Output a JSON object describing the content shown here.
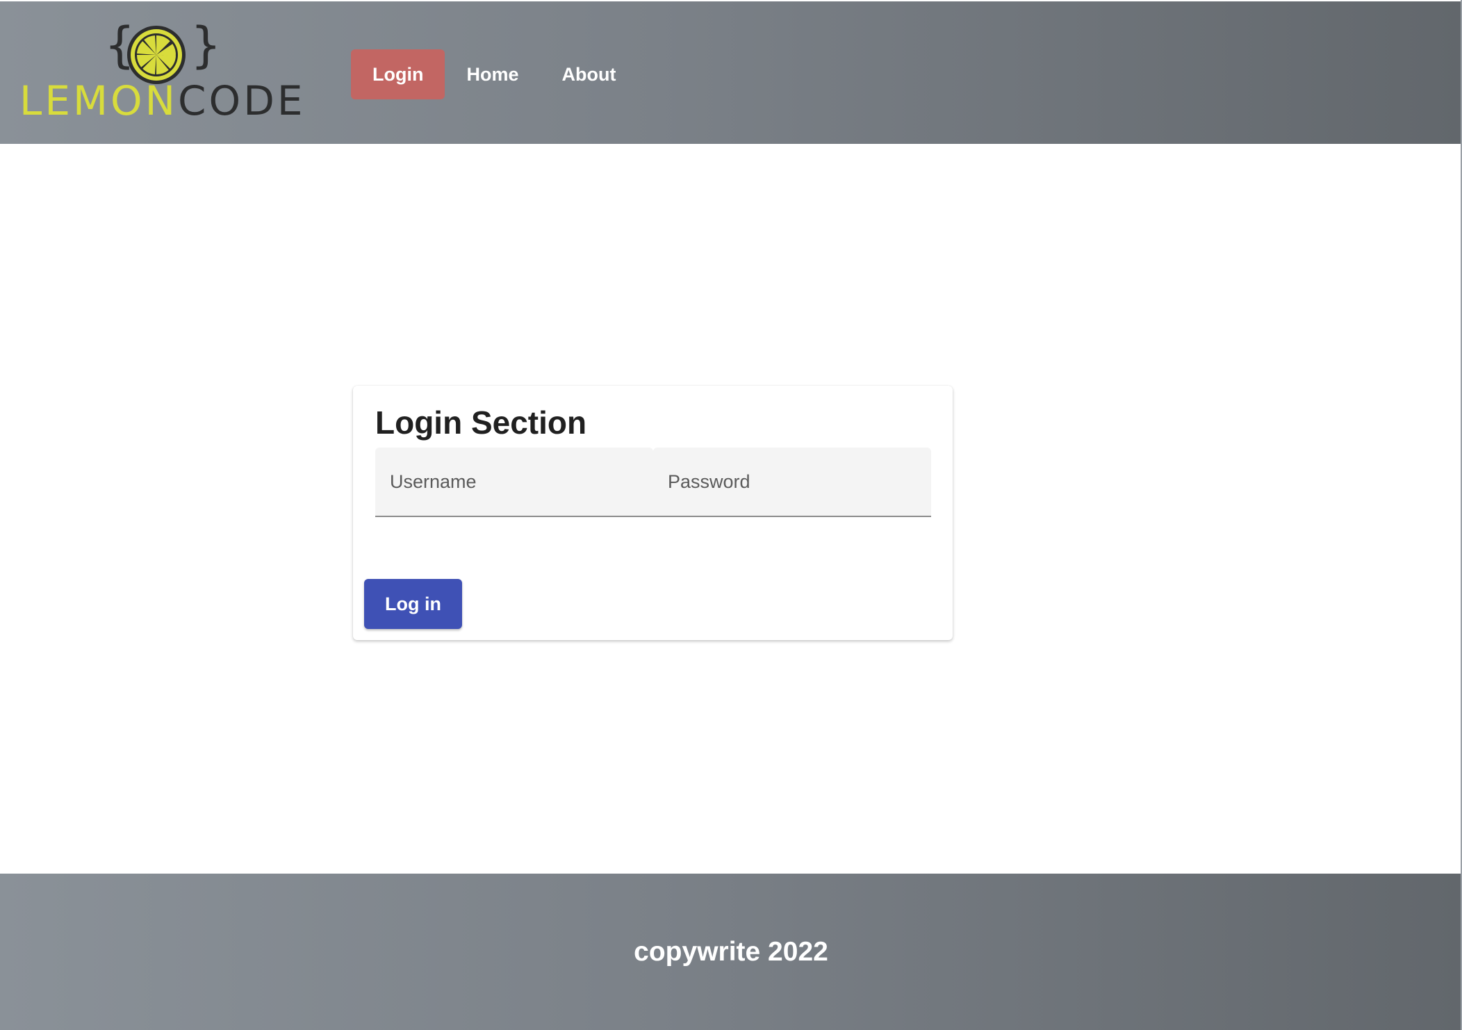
{
  "header": {
    "logo": {
      "text_lemon": "LEMON",
      "text_code": "CODE",
      "brace_left": "{",
      "brace_right": "}",
      "icon": "lemon-slice-icon",
      "colors": {
        "lemon": "#d8dc3c",
        "code": "#2c2d2e"
      }
    },
    "nav": [
      {
        "label": "Login",
        "active": true
      },
      {
        "label": "Home",
        "active": false
      },
      {
        "label": "About",
        "active": false
      }
    ]
  },
  "login_card": {
    "title": "Login Section",
    "username_placeholder": "Username",
    "password_placeholder": "Password",
    "submit_label": "Log in"
  },
  "footer": {
    "text": "copywrite 2022"
  },
  "colors": {
    "nav_active": "#c26663",
    "primary_button": "#3f51b5",
    "header_gradient_start": "#8a9198",
    "header_gradient_end": "#62676c"
  }
}
